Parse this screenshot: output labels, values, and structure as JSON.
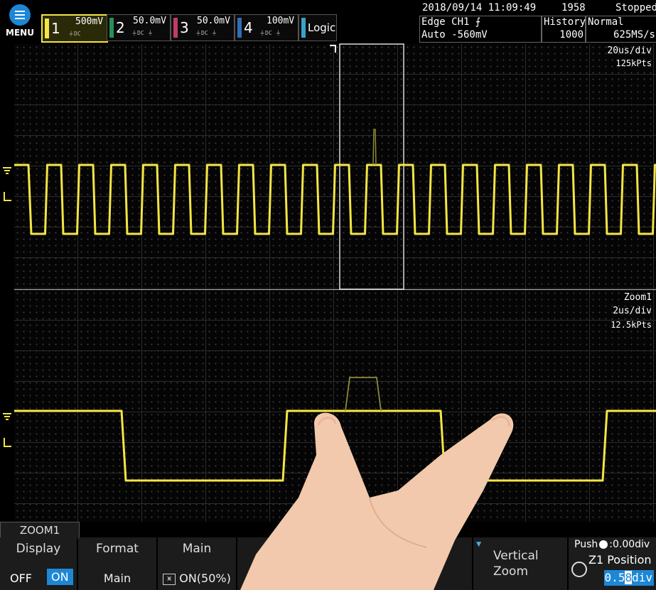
{
  "menu": {
    "label": "MENU"
  },
  "channels": [
    {
      "num": "1",
      "volts": "500mV",
      "color": "#f4e542"
    },
    {
      "num": "2",
      "volts": "50.0mV",
      "color": "#2a8f55"
    },
    {
      "num": "3",
      "volts": "50.0mV",
      "color": "#c23a6a"
    },
    {
      "num": "4",
      "volts": "100mV",
      "color": "#2f6fb5"
    }
  ],
  "logic": {
    "label": "Logic"
  },
  "status": {
    "datetime": "2018/09/14 11:09:49",
    "acq_count": "1958",
    "state": "Stopped",
    "trigger_type": "Edge CH1",
    "trigger_mode": "Auto -560mV",
    "history_label": "History",
    "history_value": "1000",
    "acq_mode": "Normal",
    "sample_rate": "625MS/s"
  },
  "main_window": {
    "timebase": "20us/div",
    "record_length": "125kPts"
  },
  "zoom_window": {
    "name": "Zoom1",
    "timebase": "2us/div",
    "record_length": "12.5kPts"
  },
  "softkeys": {
    "tab": "ZOOM1",
    "display": {
      "title": "Display",
      "off": "OFF",
      "on": "ON"
    },
    "format": {
      "title": "Format",
      "value": "Main"
    },
    "main": {
      "title": "Main",
      "value": "ON(50%)"
    },
    "vertical_zoom": {
      "line1": "Vertical",
      "line2": "Zoom"
    },
    "position": {
      "push": "Push",
      "push_value": ":0.00div",
      "title": "Z1 Position",
      "value_a": "0.5",
      "value_b": "8",
      "unit": "div"
    }
  },
  "colors": {
    "trace": "#f4e542",
    "accent": "#1d87d6"
  }
}
